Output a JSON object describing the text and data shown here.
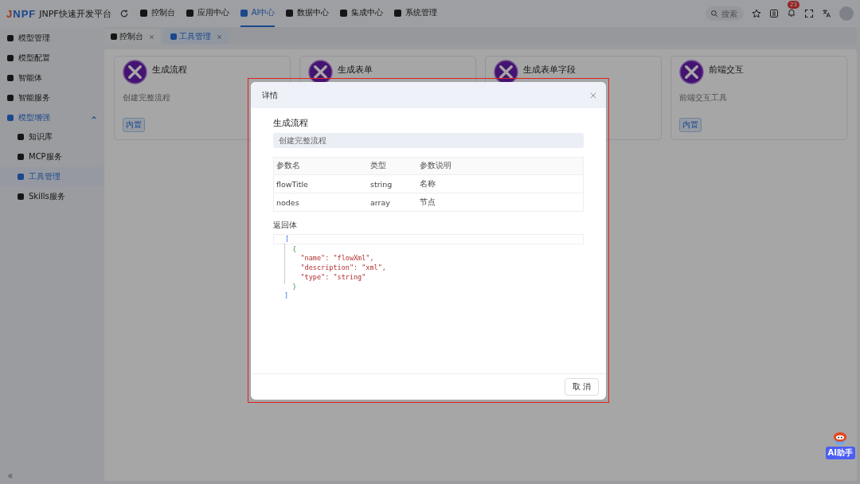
{
  "header": {
    "logo": "JNPF",
    "title": "JNPF快速开发平台",
    "nav": [
      {
        "label": "控制台",
        "selected": false
      },
      {
        "label": "应用中心",
        "selected": false
      },
      {
        "label": "AI中心",
        "selected": true
      },
      {
        "label": "数据中心",
        "selected": false
      },
      {
        "label": "集成中心",
        "selected": false
      },
      {
        "label": "系统管理",
        "selected": false
      }
    ],
    "search": {
      "placeholder": "搜索"
    },
    "notifications": "23"
  },
  "sidebar": {
    "items": [
      {
        "label": "模型管理",
        "selected": false
      },
      {
        "label": "模型配置",
        "selected": false
      },
      {
        "label": "智能体",
        "selected": false
      },
      {
        "label": "智能服务",
        "selected": false
      },
      {
        "label": "模型增强",
        "selected": true,
        "expanded": true,
        "children": [
          {
            "label": "知识库",
            "selected": false
          },
          {
            "label": "MCP服务",
            "selected": false
          },
          {
            "label": "工具管理",
            "selected": true
          },
          {
            "label": "Skills服务",
            "selected": false
          }
        ]
      }
    ]
  },
  "tabs": [
    {
      "label": "控制台",
      "selected": false
    },
    {
      "label": "工具管理",
      "selected": true
    }
  ],
  "cards": [
    {
      "title": "生成流程",
      "description": "创建完整流程",
      "tag": "内置"
    },
    {
      "title": "生成表单"
    },
    {
      "title": "生成表单字段"
    },
    {
      "title": "前端交互",
      "description": "前端交互工具",
      "tag": "内置"
    }
  ],
  "dialog": {
    "title": "详情",
    "name": "生成流程",
    "description": "创建完整流程",
    "table": {
      "columns": [
        "参数名",
        "类型",
        "参数说明"
      ],
      "rows": [
        [
          "flowTitle",
          "string",
          "名称"
        ],
        [
          "nodes",
          "array",
          "节点"
        ]
      ]
    },
    "response_label": "返回体",
    "code": [
      {
        "kind": "bracket",
        "text": "["
      },
      {
        "kind": "brace",
        "text": "  {"
      },
      {
        "kind": "pair",
        "text": "    \"name\": \"flowXml\","
      },
      {
        "kind": "pair",
        "text": "    \"description\": \"xml\","
      },
      {
        "kind": "pair",
        "text": "    \"type\": \"string\""
      },
      {
        "kind": "brace",
        "text": "  }"
      },
      {
        "kind": "bracket",
        "text": "]"
      }
    ],
    "cancel": "取 消"
  },
  "assistant": "AI助手"
}
